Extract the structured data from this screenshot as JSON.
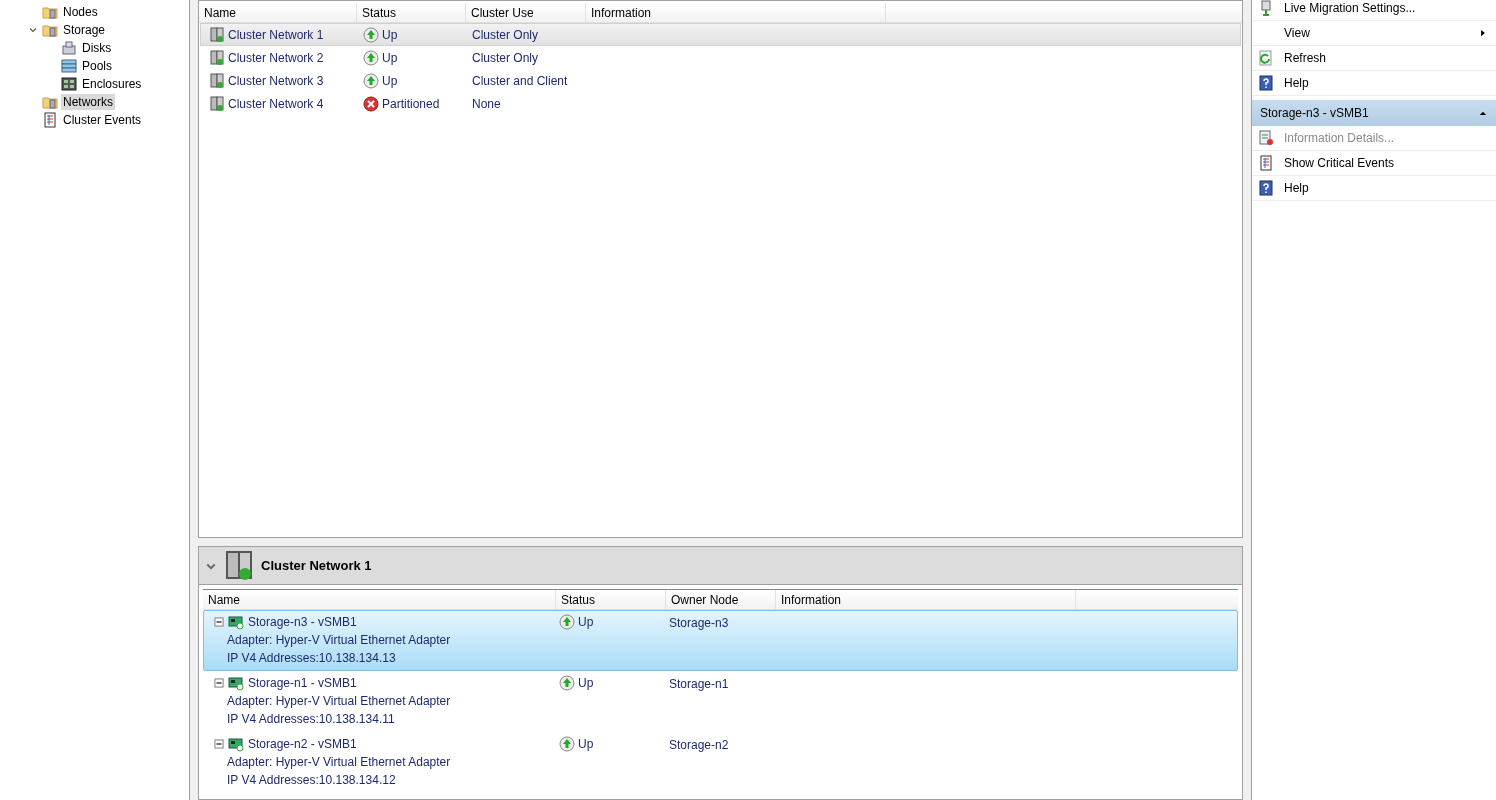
{
  "tree": [
    {
      "label": "Nodes",
      "kind": "folder",
      "selected": false
    },
    {
      "label": "Storage",
      "kind": "folder",
      "selected": false,
      "expanded": true,
      "children": [
        {
          "label": "Disks",
          "kind": "disk",
          "selected": false
        },
        {
          "label": "Pools",
          "kind": "pool",
          "selected": false
        },
        {
          "label": "Enclosures",
          "kind": "enclosure",
          "selected": false
        }
      ]
    },
    {
      "label": "Networks",
      "kind": "folder",
      "selected": true
    },
    {
      "label": "Cluster Events",
      "kind": "events",
      "selected": false
    }
  ],
  "networks": {
    "columns": [
      "Name",
      "Status",
      "Cluster Use",
      "Information"
    ],
    "rows": [
      {
        "name": "Cluster Network 1",
        "status": "Up",
        "kind": "up",
        "cluster_use": "Cluster Only",
        "selected": true
      },
      {
        "name": "Cluster Network 2",
        "status": "Up",
        "kind": "up",
        "cluster_use": "Cluster Only",
        "selected": false
      },
      {
        "name": "Cluster Network 3",
        "status": "Up",
        "kind": "up",
        "cluster_use": "Cluster and Client",
        "selected": false
      },
      {
        "name": "Cluster Network 4",
        "status": "Partitioned",
        "kind": "down",
        "cluster_use": "None",
        "selected": false
      }
    ]
  },
  "details": {
    "title": "Cluster Network 1",
    "expanded": true,
    "columns": [
      "Name",
      "Status",
      "Owner Node",
      "Information"
    ],
    "rows": [
      {
        "name": "Storage-n3 - vSMB1",
        "adapter": "Adapter: Hyper-V Virtual Ethernet Adapter",
        "ip": "IP V4 Addresses:10.138.134.13",
        "status": "Up",
        "kind": "up",
        "owner": "Storage-n3",
        "selected": true,
        "expanded": true
      },
      {
        "name": "Storage-n1 - vSMB1",
        "adapter": "Adapter: Hyper-V Virtual Ethernet Adapter",
        "ip": "IP V4 Addresses:10.138.134.11",
        "status": "Up",
        "kind": "up",
        "owner": "Storage-n1",
        "selected": false,
        "expanded": true
      },
      {
        "name": "Storage-n2 - vSMB1",
        "adapter": "Adapter: Hyper-V Virtual Ethernet Adapter",
        "ip": "IP V4 Addresses:10.138.134.12",
        "status": "Up",
        "kind": "up",
        "owner": "Storage-n2",
        "selected": false,
        "expanded": true
      }
    ]
  },
  "actions": {
    "items": [
      {
        "label": "Live Migration Settings...",
        "kind": "migration",
        "disabled": false,
        "submenu": false
      },
      {
        "label": "View",
        "kind": "none",
        "disabled": false,
        "submenu": true
      },
      {
        "label": "Refresh",
        "kind": "refresh",
        "disabled": false,
        "submenu": false
      },
      {
        "label": "Help",
        "kind": "help",
        "disabled": false,
        "submenu": false
      }
    ],
    "section": {
      "title": "Storage-n3 - vSMB1",
      "expanded": true,
      "items": [
        {
          "label": "Information Details...",
          "kind": "info",
          "disabled": true,
          "submenu": false
        },
        {
          "label": "Show Critical Events",
          "kind": "events",
          "disabled": false,
          "submenu": false
        },
        {
          "label": "Help",
          "kind": "help",
          "disabled": false,
          "submenu": false
        }
      ]
    }
  }
}
